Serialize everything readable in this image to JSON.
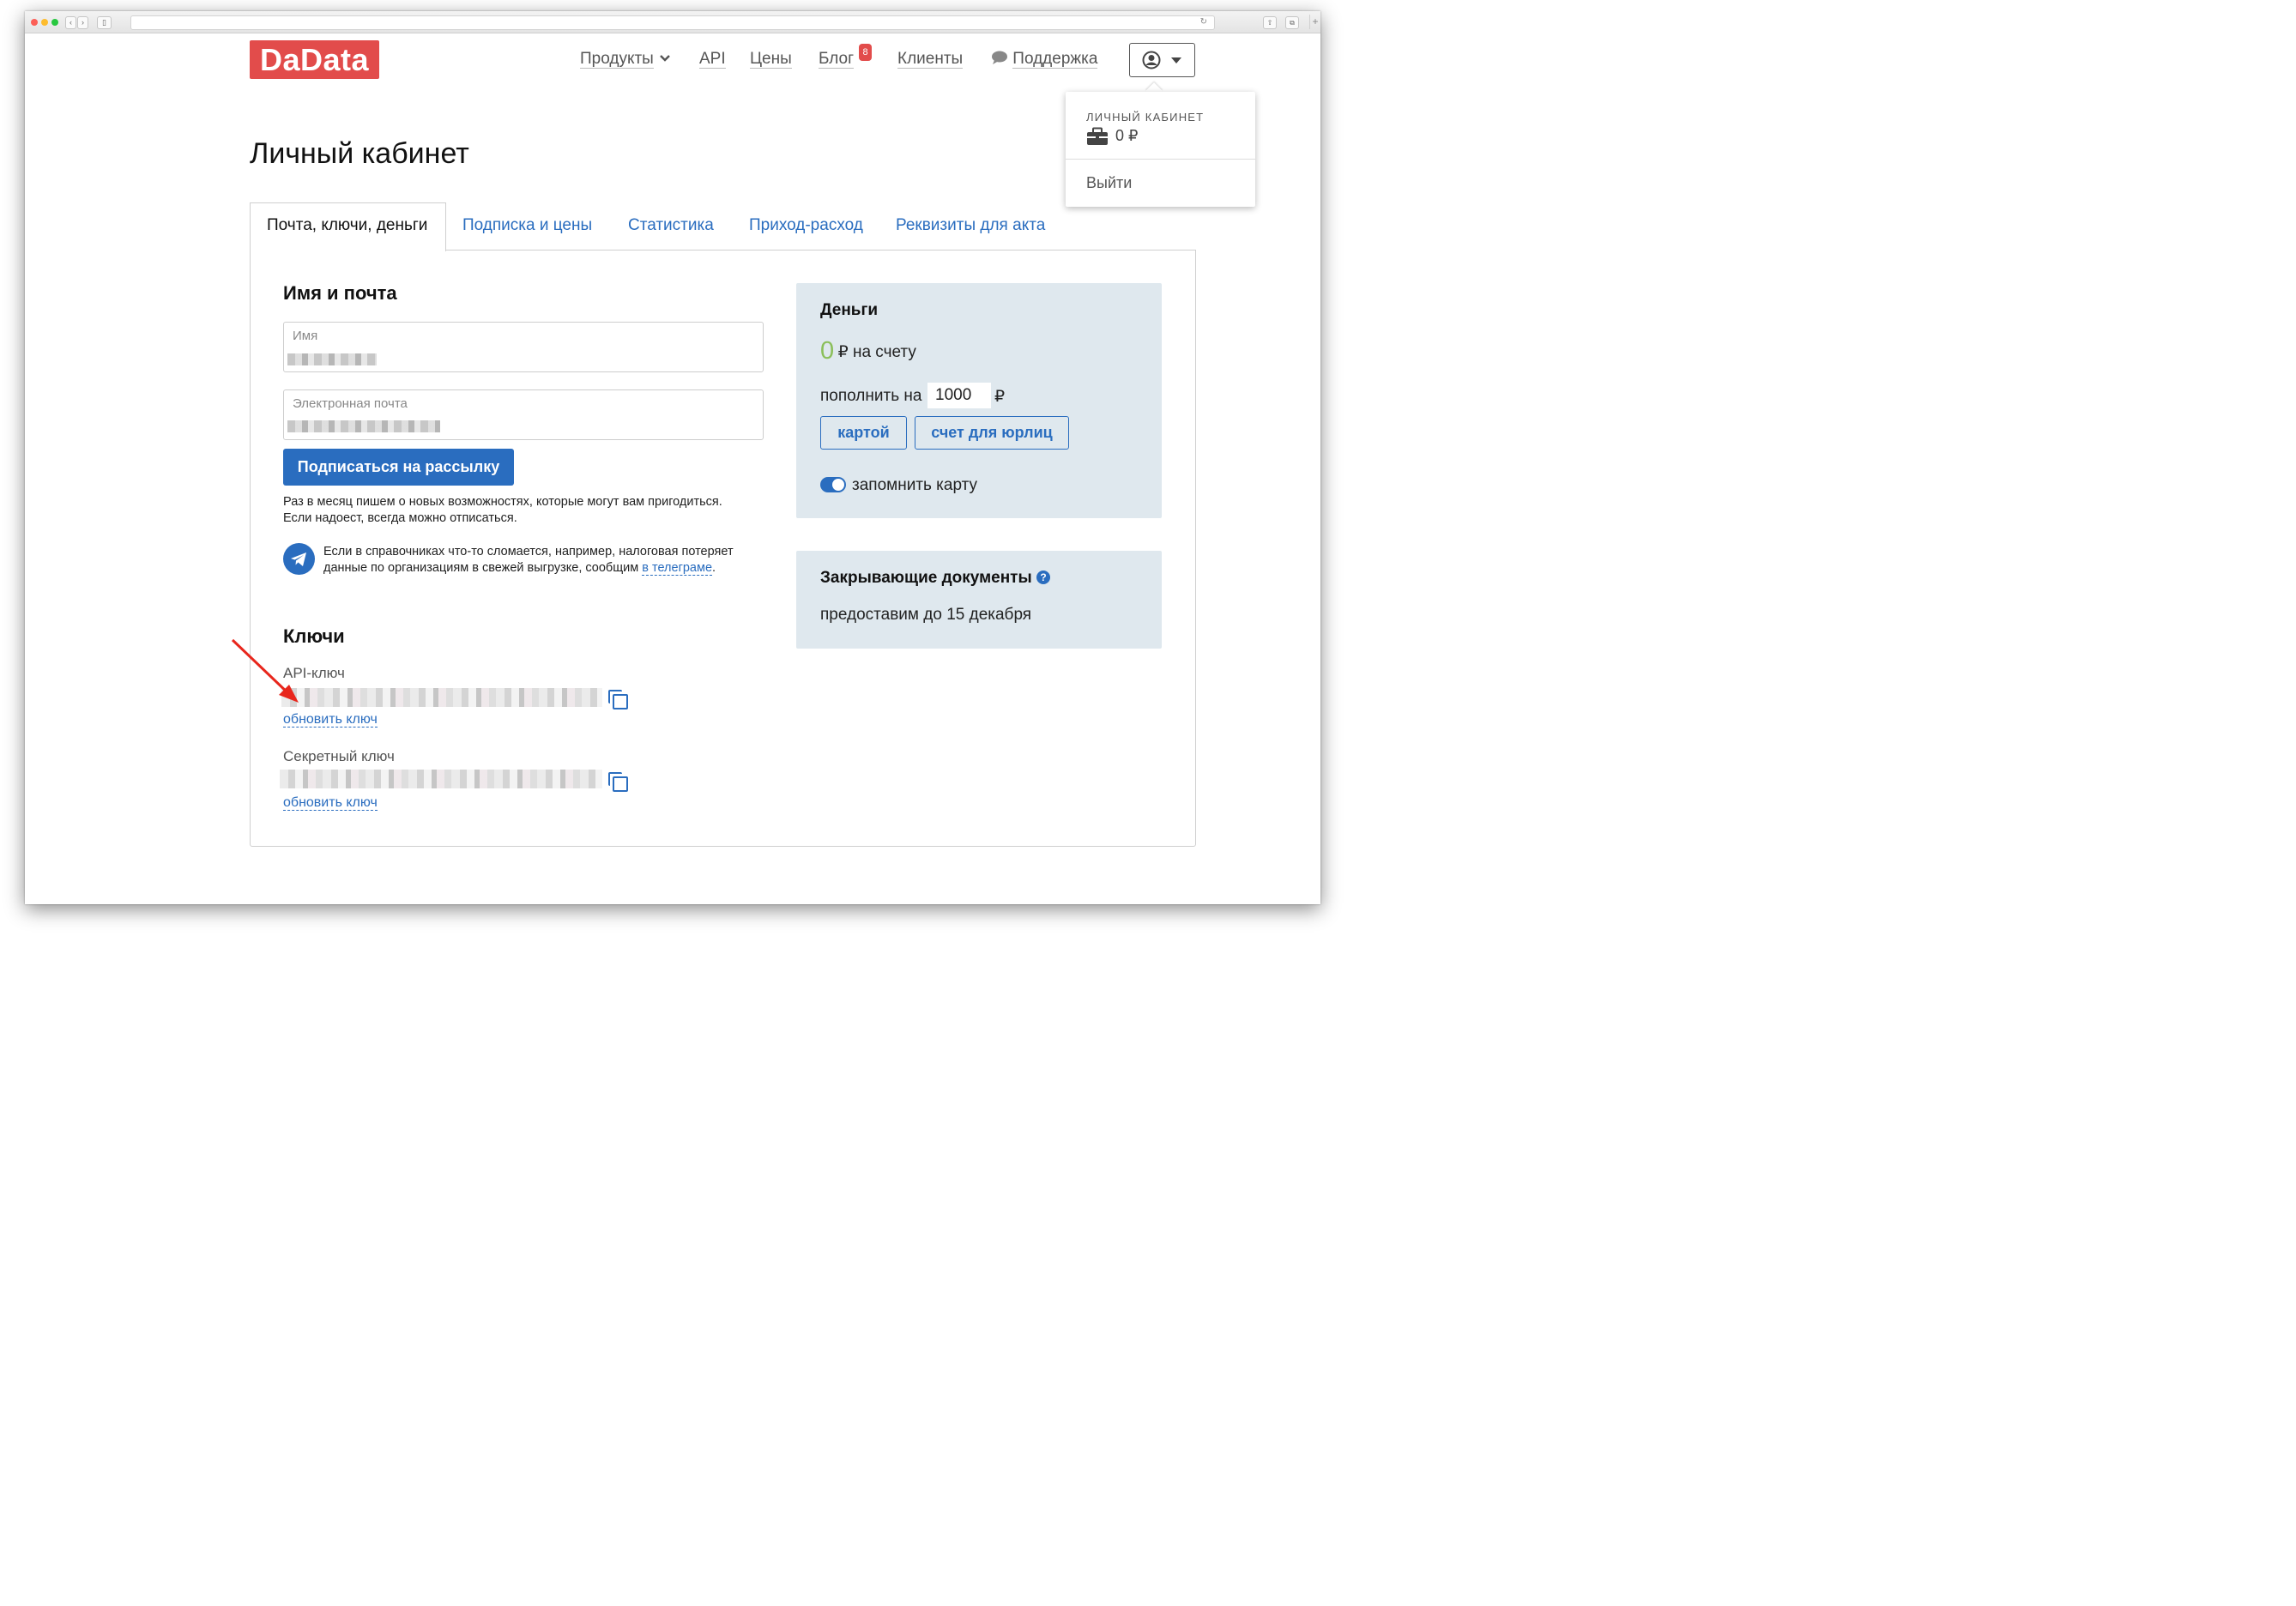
{
  "nav": {
    "logo": "DaData",
    "products": "Продукты",
    "api": "API",
    "prices": "Цены",
    "blog": "Блог",
    "blog_badge": "8",
    "clients": "Клиенты",
    "support": "Поддержка"
  },
  "dropdown": {
    "section": "ЛИЧНЫЙ КАБИНЕТ",
    "balance": "0 ₽",
    "logout": "Выйти"
  },
  "page": {
    "title": "Личный кабинет"
  },
  "tabs": [
    {
      "label": "Почта, ключи, деньги",
      "active": true
    },
    {
      "label": "Подписка и цены"
    },
    {
      "label": "Статистика"
    },
    {
      "label": "Приход-расход"
    },
    {
      "label": "Реквизиты для акта"
    }
  ],
  "profile": {
    "heading": "Имя и почта",
    "name_label": "Имя",
    "email_label": "Электронная почта",
    "subscribe_button": "Подписаться на рассылку",
    "subscribe_note_1": "Раз в месяц пишем о новых возможностях, которые могут вам пригодиться.",
    "subscribe_note_2": "Если надоест, всегда можно отписаться.",
    "telegram_note_1": "Если в справочниках что-то сломается, например, налоговая потеряет",
    "telegram_note_2": "данные по организациям в свежей выгрузке, сообщим ",
    "telegram_link": "в телеграме",
    "telegram_end": "."
  },
  "keys": {
    "heading": "Ключи",
    "api_label": "API-ключ",
    "api_refresh": "обновить ключ",
    "secret_label": "Секретный ключ",
    "secret_refresh": "обновить ключ"
  },
  "money": {
    "heading": "Деньги",
    "balance": "0",
    "balance_suffix": "₽ на счету",
    "topup_label": "пополнить на",
    "topup_value": "1000",
    "currency": "₽",
    "card_button": "картой",
    "invoice_button": "счет для юрлиц",
    "remember_card": "запомнить карту",
    "remember_on": true
  },
  "docs": {
    "heading": "Закрывающие документы",
    "help_icon": "?",
    "text": "предоставим до 15 декабря"
  },
  "colors": {
    "brand": "#e24c4b",
    "accent": "#2a6dbf",
    "card_bg": "#dfe8ee",
    "balance_green": "#8bbf5a",
    "annotation_arrow": "#e8261c"
  }
}
